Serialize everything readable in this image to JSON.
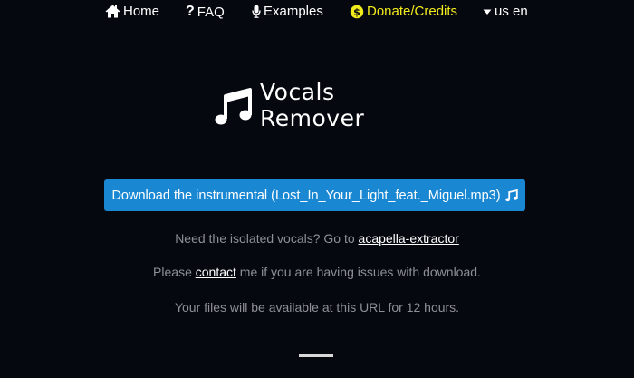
{
  "nav": {
    "home": "Home",
    "faq": "FAQ",
    "examples": "Examples",
    "donate": "Donate/Credits",
    "language": "us en"
  },
  "logo": {
    "line1": "Vocals",
    "line2": "Remover",
    "icon": "music-note-icon"
  },
  "download": {
    "label": "Download the instrumental (Lost_In_Your_Light_feat._Miguel.mp3)",
    "icon": "music-note-icon"
  },
  "vocals_line": {
    "prefix": "Need the isolated vocals? Go to ",
    "link": "acapella-extractor"
  },
  "contact_line": {
    "prefix": "Please ",
    "link": "contact",
    "suffix": " me if you are having issues with download."
  },
  "availability_text": "Your files will be available at this URL for 12 hours.",
  "colors": {
    "background": "#06080f",
    "button": "#1a87d3",
    "donate": "#f3ec1c",
    "muted_text": "#8e9097"
  }
}
